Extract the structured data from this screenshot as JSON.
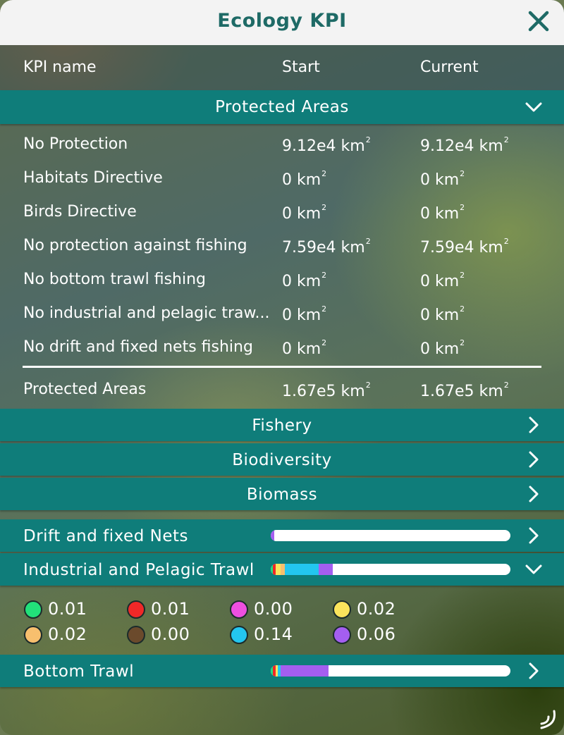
{
  "window": {
    "title": "Ecology KPI"
  },
  "header": {
    "col_name": "KPI name",
    "col_start": "Start",
    "col_current": "Current"
  },
  "protected": {
    "label": "Protected Areas",
    "rows": [
      {
        "name": "No Protection",
        "start": "9.12e4 km",
        "current": "9.12e4 km"
      },
      {
        "name": "Habitats Directive",
        "start": "0 km",
        "current": "0 km"
      },
      {
        "name": "Birds Directive",
        "start": "0 km",
        "current": "0 km"
      },
      {
        "name": "No protection against fishing",
        "start": "7.59e4 km",
        "current": "7.59e4 km"
      },
      {
        "name": "No bottom trawl fishing",
        "start": "0 km",
        "current": "0 km"
      },
      {
        "name": "No industrial and pelagic traw...",
        "start": "0 km",
        "current": "0 km"
      },
      {
        "name": "No drift and fixed nets fishing",
        "start": "0 km",
        "current": "0 km"
      }
    ],
    "total": {
      "name": "Protected Areas",
      "start": "1.67e5 km",
      "current": "1.67e5 km"
    },
    "unit_exp": "2"
  },
  "sections": {
    "fishery": "Fishery",
    "biodiversity": "Biodiversity",
    "biomass": "Biomass"
  },
  "gear": {
    "drift": {
      "label": "Drift and fixed Nets",
      "expanded": false
    },
    "industrial": {
      "label": "Industrial and Pelagic Trawl",
      "expanded": true
    },
    "bottom": {
      "label": "Bottom Trawl",
      "expanded": false
    }
  },
  "legend": [
    {
      "value": "0.01",
      "color": "#22e07a"
    },
    {
      "value": "0.01",
      "color": "#f02828"
    },
    {
      "value": "0.00",
      "color": "#ee4fe0"
    },
    {
      "value": "0.02",
      "color": "#fbe45c"
    },
    {
      "value": "0.02",
      "color": "#f7bf6e"
    },
    {
      "value": "0.00",
      "color": "#6b4a2c"
    },
    {
      "value": "0.14",
      "color": "#23c6f0"
    },
    {
      "value": "0.06",
      "color": "#a45ef0"
    }
  ],
  "bars": {
    "drift": [
      {
        "color": "#a45ef0",
        "fraction": 0.015
      }
    ],
    "industrial": [
      {
        "color": "#22e07a",
        "fraction": 0.01
      },
      {
        "color": "#f02828",
        "fraction": 0.01
      },
      {
        "color": "#fbe45c",
        "fraction": 0.02
      },
      {
        "color": "#f7bf6e",
        "fraction": 0.02
      },
      {
        "color": "#23c6f0",
        "fraction": 0.14
      },
      {
        "color": "#a45ef0",
        "fraction": 0.06
      }
    ],
    "bottom": [
      {
        "color": "#22e07a",
        "fraction": 0.01
      },
      {
        "color": "#f02828",
        "fraction": 0.01
      },
      {
        "color": "#fbe45c",
        "fraction": 0.01
      },
      {
        "color": "#23c6f0",
        "fraction": 0.01
      },
      {
        "color": "#a45ef0",
        "fraction": 0.2
      }
    ]
  }
}
